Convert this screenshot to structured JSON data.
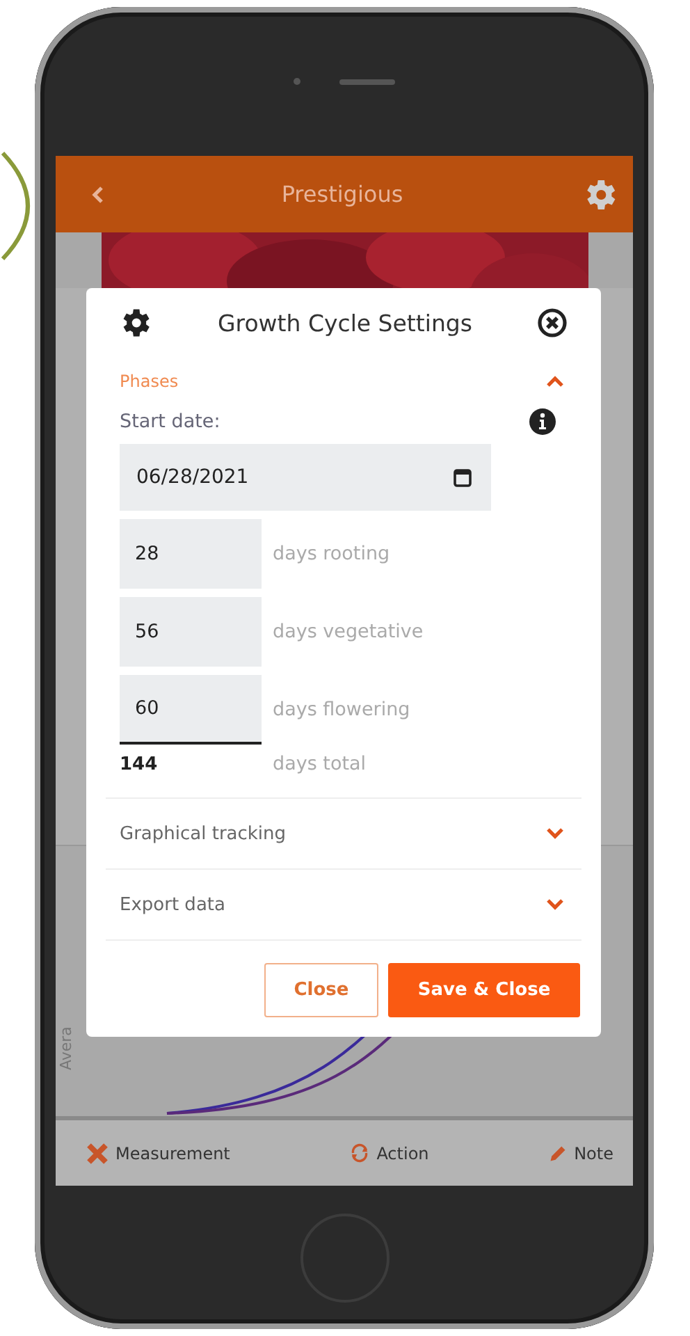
{
  "header": {
    "title": "Prestigious"
  },
  "dialog": {
    "title": "Growth Cycle Settings",
    "sections": [
      {
        "kind": "phases",
        "title": "Phases",
        "expanded": true
      },
      {
        "kind": "plain",
        "title": "Graphical tracking",
        "expanded": false
      },
      {
        "kind": "plain",
        "title": "Export data",
        "expanded": false
      }
    ],
    "start_date": {
      "label": "Start date:",
      "value": "06/28/2021"
    },
    "phases": [
      {
        "value": "28",
        "label": "days rooting"
      },
      {
        "value": "56",
        "label": "days vegetative"
      },
      {
        "value": "60",
        "label": "days flowering"
      }
    ],
    "total": {
      "value": "144",
      "label": "days total"
    },
    "buttons": [
      {
        "kind": "secondary",
        "label": "Close"
      },
      {
        "kind": "primary",
        "label": "Save & Close"
      }
    ]
  },
  "chart": {
    "axis_label": "Avera"
  },
  "toolbar": [
    {
      "kind": "measurement",
      "label": "Measurement"
    },
    {
      "kind": "action",
      "label": "Action"
    },
    {
      "kind": "note",
      "label": "Note"
    }
  ]
}
